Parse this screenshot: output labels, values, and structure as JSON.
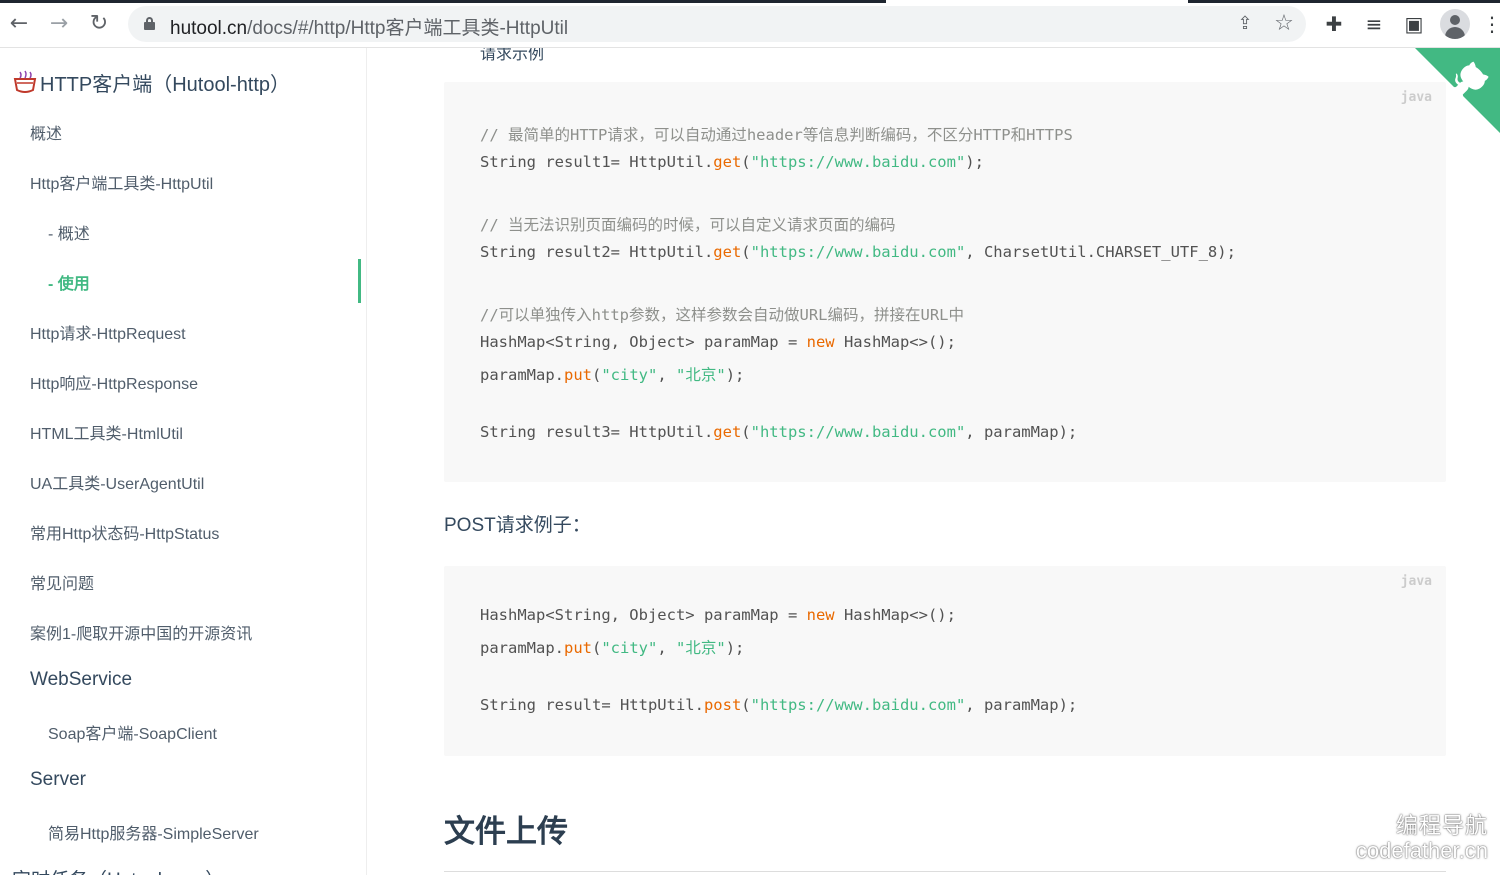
{
  "browser": {
    "url_host": "hutool.cn",
    "url_path": "/docs/#/http/Http客户端工具类-HttpUtil",
    "back_glyph": "←",
    "forward_glyph": "→",
    "reload_glyph": "↻",
    "share_glyph": "⇪",
    "star_glyph": "☆",
    "extensions_glyph": "✚",
    "media_glyph": "≡",
    "sidepanel_glyph": "▣",
    "menu_glyph": "⋮",
    "icons": [
      "back-icon",
      "forward-icon",
      "reload-icon",
      "lock-icon",
      "share-icon",
      "star-icon",
      "puzzle-icon",
      "media-icon",
      "side-panel-icon",
      "profile-icon",
      "kebab-icon"
    ]
  },
  "sidebar": {
    "title": "HTTP客户端（Hutool-http）",
    "items": [
      "概述",
      "Http客户端工具类-HttpUtil",
      "- 概述",
      "- 使用",
      "Http请求-HttpRequest",
      "Http响应-HttpResponse",
      "HTML工具类-HtmlUtil",
      "UA工具类-UserAgentUtil",
      "常用Http状态码-HttpStatus",
      "常见问题",
      "案例1-爬取开源中国的开源资讯",
      "WebService",
      "Soap客户端-SoapClient",
      "Server",
      "简易Http服务器-SimpleServer",
      "定时任务（Hutool-cron）"
    ],
    "active_index": 3,
    "accent": "#42b983"
  },
  "main": {
    "cut_text": "请求示例",
    "code1": {
      "lang": "java",
      "lines": [
        "// 最简单的HTTP请求，可以自动通过header等信息判断编码，不区分HTTP和HTTPS",
        "String result1= HttpUtil.get(\"https://www.baidu.com\");",
        "// 当无法识别页面编码的时候，可以自定义请求页面的编码",
        "String result2= HttpUtil.get(\"https://www.baidu.com\", CharsetUtil.CHARSET_UTF_8);",
        "//可以单独传入http参数，这样参数会自动做URL编码，拼接在URL中",
        "HashMap<String, Object> paramMap = new HashMap<>();",
        "paramMap.put(\"city\", \"北京\");",
        "String result3= HttpUtil.get(\"https://www.baidu.com\", paramMap);"
      ]
    },
    "post_label": "POST请求例子：",
    "code2": {
      "lang": "java",
      "lines": [
        "HashMap<String, Object> paramMap = new HashMap<>();",
        "paramMap.put(\"city\", \"北京\");",
        "String result= HttpUtil.post(\"https://www.baidu.com\", paramMap);"
      ]
    },
    "heading": "文件上传"
  },
  "watermark": {
    "line1": "编程导航",
    "line2": "codefather.cn"
  },
  "colors": {
    "accent": "#42b983",
    "code_bg": "#f8f8f8",
    "token_function": "#e96900",
    "token_string": "#42b983",
    "comment": "#8e908c"
  }
}
